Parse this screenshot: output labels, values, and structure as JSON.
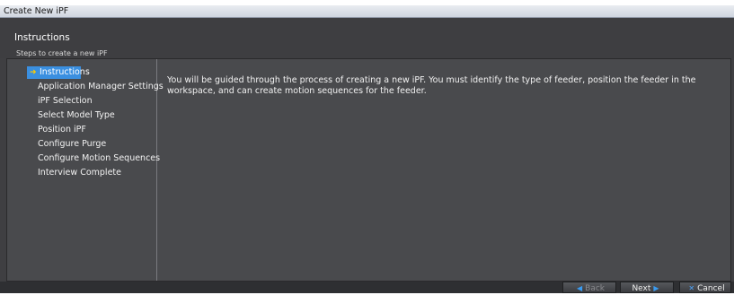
{
  "window": {
    "title": "Create New iPF"
  },
  "header": {
    "title": "Instructions",
    "subtitle": "Steps to create a new iPF"
  },
  "steps": [
    {
      "label": "Instructions",
      "selected": true
    },
    {
      "label": "Application Manager Settings",
      "selected": false
    },
    {
      "label": "iPF Selection",
      "selected": false
    },
    {
      "label": "Select Model Type",
      "selected": false
    },
    {
      "label": "Position iPF",
      "selected": false
    },
    {
      "label": "Configure Purge",
      "selected": false
    },
    {
      "label": "Configure Motion Sequences",
      "selected": false
    },
    {
      "label": "Interview Complete",
      "selected": false
    }
  ],
  "main": {
    "description": "You will be guided through the process of creating a new iPF. You must identify the type of feeder, position the feeder in the workspace, and can create motion sequences for the feeder."
  },
  "footer": {
    "back_label": "Back",
    "next_label": "Next",
    "cancel_label": "Cancel"
  },
  "colors": {
    "accent": "#3a8fe0",
    "background": "#494a4d",
    "arrow": "#ffcc00"
  },
  "icons": {
    "back": "left-arrow-icon",
    "next": "right-arrow-icon",
    "cancel": "close-icon",
    "current_step": "current-step-arrow-icon"
  }
}
